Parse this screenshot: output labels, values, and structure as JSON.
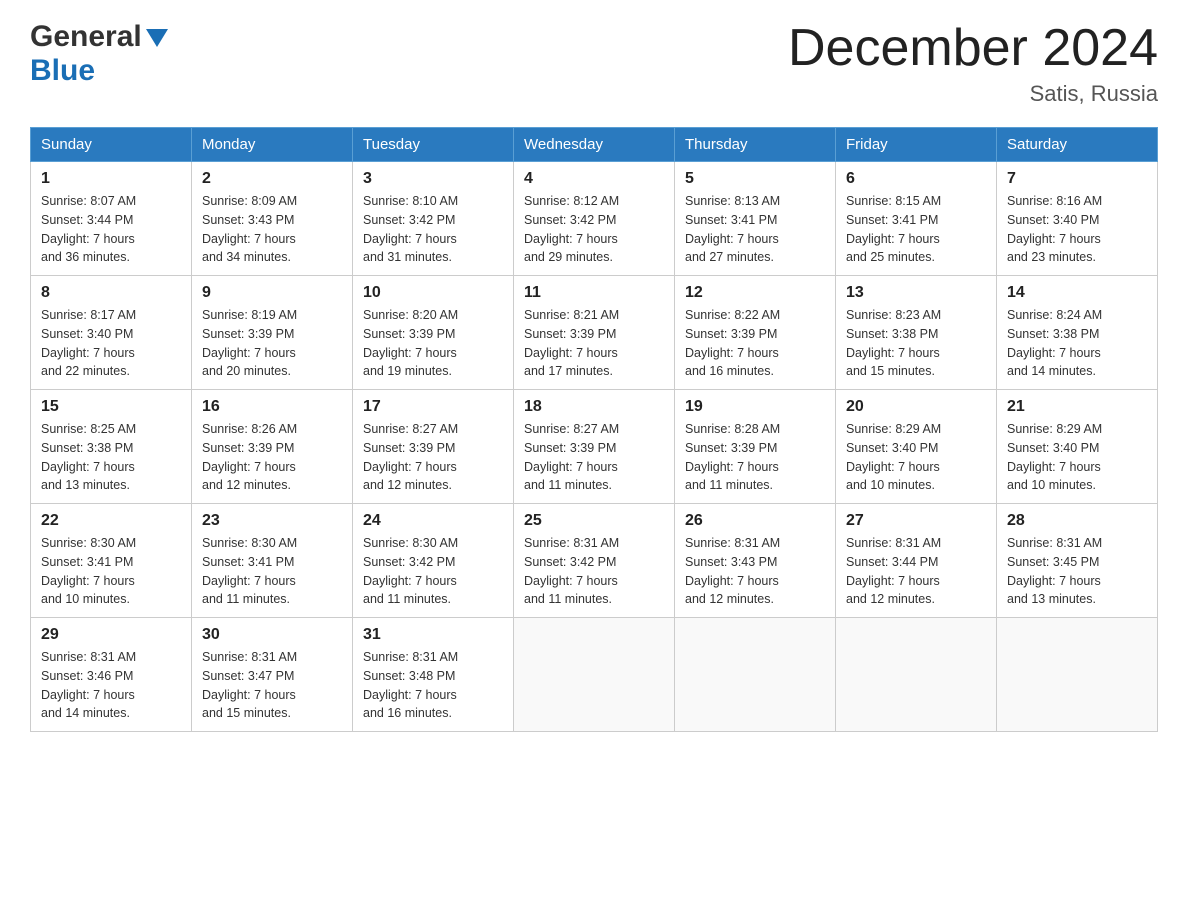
{
  "header": {
    "logo_general": "General",
    "logo_blue": "Blue",
    "month_title": "December 2024",
    "location": "Satis, Russia"
  },
  "calendar": {
    "days_of_week": [
      "Sunday",
      "Monday",
      "Tuesday",
      "Wednesday",
      "Thursday",
      "Friday",
      "Saturday"
    ],
    "weeks": [
      [
        {
          "day": "1",
          "sunrise": "8:07 AM",
          "sunset": "3:44 PM",
          "daylight": "7 hours and 36 minutes."
        },
        {
          "day": "2",
          "sunrise": "8:09 AM",
          "sunset": "3:43 PM",
          "daylight": "7 hours and 34 minutes."
        },
        {
          "day": "3",
          "sunrise": "8:10 AM",
          "sunset": "3:42 PM",
          "daylight": "7 hours and 31 minutes."
        },
        {
          "day": "4",
          "sunrise": "8:12 AM",
          "sunset": "3:42 PM",
          "daylight": "7 hours and 29 minutes."
        },
        {
          "day": "5",
          "sunrise": "8:13 AM",
          "sunset": "3:41 PM",
          "daylight": "7 hours and 27 minutes."
        },
        {
          "day": "6",
          "sunrise": "8:15 AM",
          "sunset": "3:41 PM",
          "daylight": "7 hours and 25 minutes."
        },
        {
          "day": "7",
          "sunrise": "8:16 AM",
          "sunset": "3:40 PM",
          "daylight": "7 hours and 23 minutes."
        }
      ],
      [
        {
          "day": "8",
          "sunrise": "8:17 AM",
          "sunset": "3:40 PM",
          "daylight": "7 hours and 22 minutes."
        },
        {
          "day": "9",
          "sunrise": "8:19 AM",
          "sunset": "3:39 PM",
          "daylight": "7 hours and 20 minutes."
        },
        {
          "day": "10",
          "sunrise": "8:20 AM",
          "sunset": "3:39 PM",
          "daylight": "7 hours and 19 minutes."
        },
        {
          "day": "11",
          "sunrise": "8:21 AM",
          "sunset": "3:39 PM",
          "daylight": "7 hours and 17 minutes."
        },
        {
          "day": "12",
          "sunrise": "8:22 AM",
          "sunset": "3:39 PM",
          "daylight": "7 hours and 16 minutes."
        },
        {
          "day": "13",
          "sunrise": "8:23 AM",
          "sunset": "3:38 PM",
          "daylight": "7 hours and 15 minutes."
        },
        {
          "day": "14",
          "sunrise": "8:24 AM",
          "sunset": "3:38 PM",
          "daylight": "7 hours and 14 minutes."
        }
      ],
      [
        {
          "day": "15",
          "sunrise": "8:25 AM",
          "sunset": "3:38 PM",
          "daylight": "7 hours and 13 minutes."
        },
        {
          "day": "16",
          "sunrise": "8:26 AM",
          "sunset": "3:39 PM",
          "daylight": "7 hours and 12 minutes."
        },
        {
          "day": "17",
          "sunrise": "8:27 AM",
          "sunset": "3:39 PM",
          "daylight": "7 hours and 12 minutes."
        },
        {
          "day": "18",
          "sunrise": "8:27 AM",
          "sunset": "3:39 PM",
          "daylight": "7 hours and 11 minutes."
        },
        {
          "day": "19",
          "sunrise": "8:28 AM",
          "sunset": "3:39 PM",
          "daylight": "7 hours and 11 minutes."
        },
        {
          "day": "20",
          "sunrise": "8:29 AM",
          "sunset": "3:40 PM",
          "daylight": "7 hours and 10 minutes."
        },
        {
          "day": "21",
          "sunrise": "8:29 AM",
          "sunset": "3:40 PM",
          "daylight": "7 hours and 10 minutes."
        }
      ],
      [
        {
          "day": "22",
          "sunrise": "8:30 AM",
          "sunset": "3:41 PM",
          "daylight": "7 hours and 10 minutes."
        },
        {
          "day": "23",
          "sunrise": "8:30 AM",
          "sunset": "3:41 PM",
          "daylight": "7 hours and 11 minutes."
        },
        {
          "day": "24",
          "sunrise": "8:30 AM",
          "sunset": "3:42 PM",
          "daylight": "7 hours and 11 minutes."
        },
        {
          "day": "25",
          "sunrise": "8:31 AM",
          "sunset": "3:42 PM",
          "daylight": "7 hours and 11 minutes."
        },
        {
          "day": "26",
          "sunrise": "8:31 AM",
          "sunset": "3:43 PM",
          "daylight": "7 hours and 12 minutes."
        },
        {
          "day": "27",
          "sunrise": "8:31 AM",
          "sunset": "3:44 PM",
          "daylight": "7 hours and 12 minutes."
        },
        {
          "day": "28",
          "sunrise": "8:31 AM",
          "sunset": "3:45 PM",
          "daylight": "7 hours and 13 minutes."
        }
      ],
      [
        {
          "day": "29",
          "sunrise": "8:31 AM",
          "sunset": "3:46 PM",
          "daylight": "7 hours and 14 minutes."
        },
        {
          "day": "30",
          "sunrise": "8:31 AM",
          "sunset": "3:47 PM",
          "daylight": "7 hours and 15 minutes."
        },
        {
          "day": "31",
          "sunrise": "8:31 AM",
          "sunset": "3:48 PM",
          "daylight": "7 hours and 16 minutes."
        },
        null,
        null,
        null,
        null
      ]
    ],
    "sunrise_label": "Sunrise:",
    "sunset_label": "Sunset:",
    "daylight_label": "Daylight:"
  }
}
